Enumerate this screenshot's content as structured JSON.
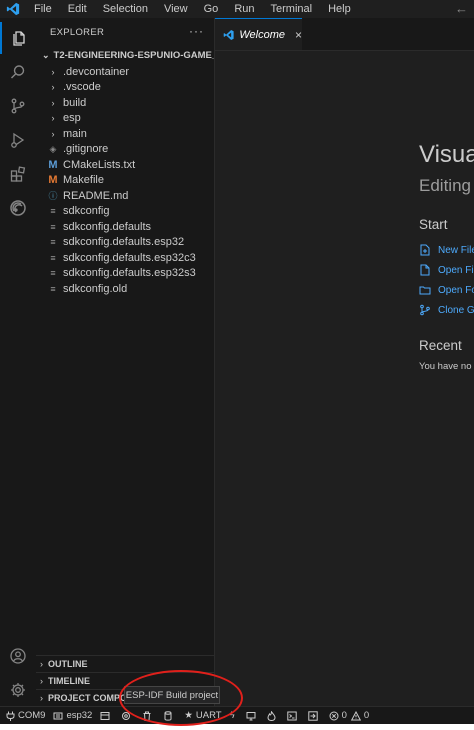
{
  "menu": [
    "File",
    "Edit",
    "Selection",
    "View",
    "Go",
    "Run",
    "Terminal",
    "Help"
  ],
  "explorer": {
    "header": "EXPLORER",
    "more": "···",
    "folder": "T2-ENGINEERING-ESPUNIO-GAME_CONTR...",
    "items": [
      {
        "label": ".devcontainer",
        "icon": "chevron-right-icon"
      },
      {
        "label": ".vscode",
        "icon": "chevron-right-icon"
      },
      {
        "label": "build",
        "icon": "chevron-right-icon"
      },
      {
        "label": "esp",
        "icon": "chevron-right-icon"
      },
      {
        "label": "main",
        "icon": "chevron-right-icon"
      },
      {
        "label": ".gitignore",
        "icon": "git-icon"
      },
      {
        "label": "CMakeLists.txt",
        "icon": "cmake-icon"
      },
      {
        "label": "Makefile",
        "icon": "makefile-icon"
      },
      {
        "label": "README.md",
        "icon": "info-icon"
      },
      {
        "label": "sdkconfig",
        "icon": "lines-icon"
      },
      {
        "label": "sdkconfig.defaults",
        "icon": "lines-icon"
      },
      {
        "label": "sdkconfig.defaults.esp32",
        "icon": "lines-icon"
      },
      {
        "label": "sdkconfig.defaults.esp32c3",
        "icon": "lines-icon"
      },
      {
        "label": "sdkconfig.defaults.esp32s3",
        "icon": "lines-icon"
      },
      {
        "label": "sdkconfig.old",
        "icon": "lines-icon"
      }
    ],
    "sections": [
      "OUTLINE",
      "TIMELINE",
      "PROJECT COMPONE"
    ]
  },
  "tab": {
    "label": "Welcome",
    "close": "×"
  },
  "welcome": {
    "title": "Visua",
    "subtitle": "Editing",
    "start_heading": "Start",
    "links": [
      "New File",
      "Open Fil",
      "Open Fo",
      "Clone Gi"
    ],
    "recent_heading": "Recent",
    "recent_empty": "You have no r"
  },
  "status": {
    "port": "COM9",
    "target": "esp32",
    "monitor_mode": "UART",
    "errors": "0",
    "warnings": "0"
  },
  "tooltip": "ESP-IDF Build project",
  "colors": {
    "accent": "#0078d4",
    "link": "#4daafc",
    "annotation": "#e0201b"
  }
}
